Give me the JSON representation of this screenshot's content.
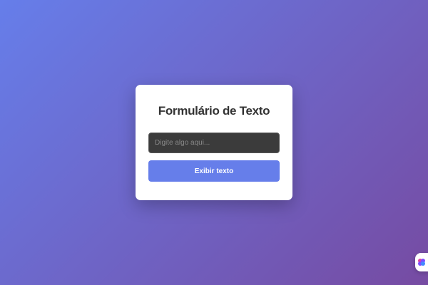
{
  "form": {
    "title": "Formulário de Texto",
    "input_placeholder": "Digite algo aqui...",
    "input_value": "",
    "button_label": "Exibir texto"
  },
  "colors": {
    "background_start": "#667eea",
    "background_end": "#764ba2",
    "button": "#667eea",
    "input_background": "#3b3b3b",
    "card": "#ffffff"
  },
  "widget": {
    "icon": "assistant-brain-icon"
  }
}
